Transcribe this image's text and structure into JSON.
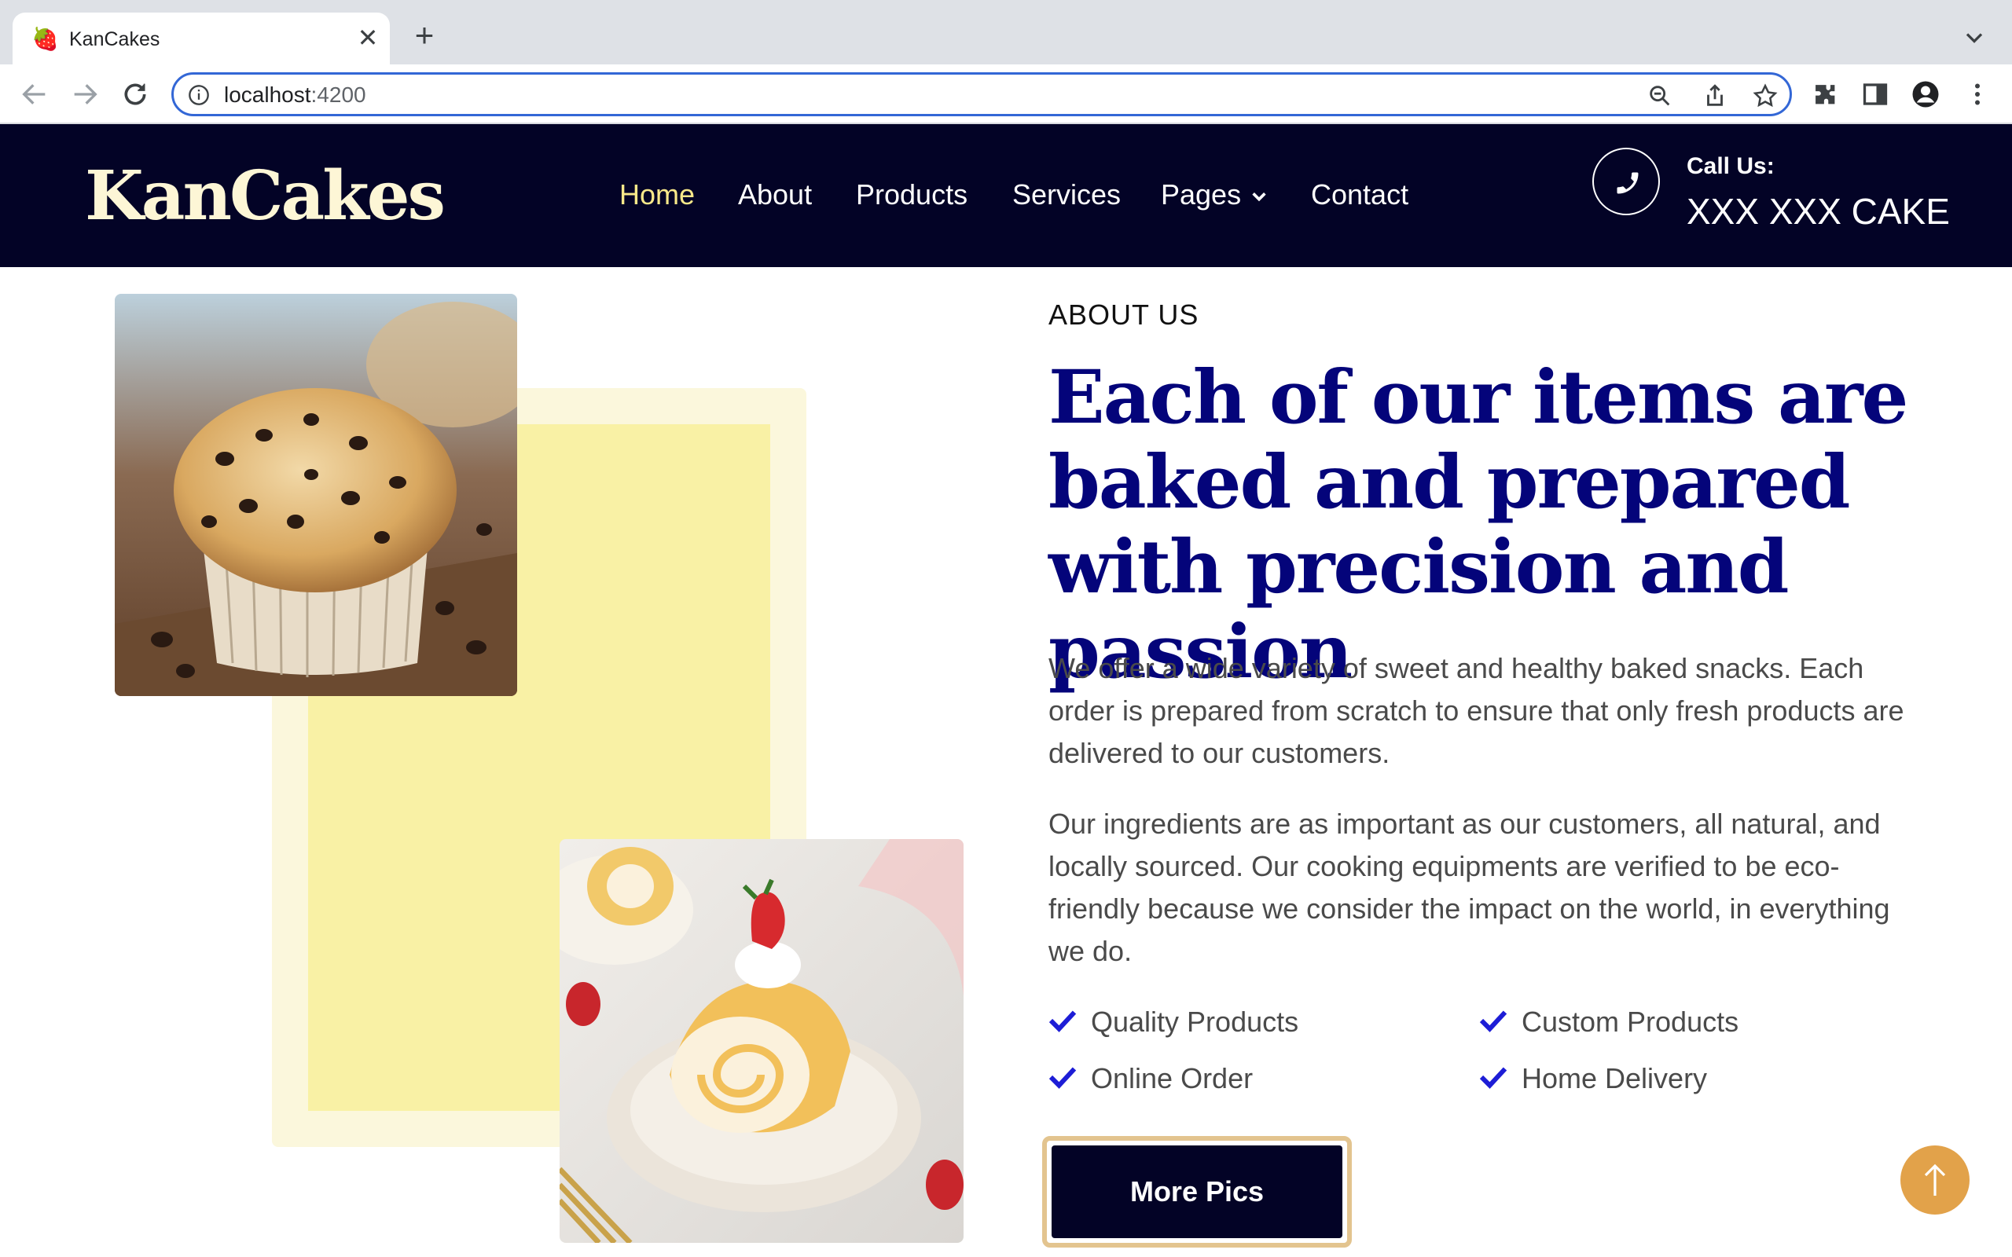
{
  "browser": {
    "tab": {
      "favicon": "🍓",
      "title": "KanCakes",
      "close": "✕"
    },
    "new_tab": "+",
    "url_host": "localhost",
    "url_port": ":4200"
  },
  "header": {
    "brand": "KanCakes",
    "nav": [
      {
        "label": "Home",
        "active": true
      },
      {
        "label": "About",
        "active": false
      },
      {
        "label": "Products",
        "active": false
      },
      {
        "label": "Services",
        "active": false
      },
      {
        "label": "Pages",
        "active": false,
        "dropdown": true
      },
      {
        "label": "Contact",
        "active": false
      }
    ],
    "call_label": "Call Us:",
    "call_number": "XXX XXX CAKE"
  },
  "about": {
    "eyebrow": "ABOUT US",
    "headline": "Each of our items are baked and prepared with precision and passion",
    "paragraph_1": "We offer a wide variety of sweet and healthy baked snacks. Each order is prepared from scratch to ensure that only fresh products are delivered to our customers.",
    "paragraph_2": "Our ingredients are as important as our customers, all natural, and locally sourced. Our cooking equipments are verified to be eco-friendly because we consider the impact on the world, in everything we do.",
    "features": [
      "Quality Products",
      "Custom Products",
      "Online Order",
      "Home Delivery"
    ],
    "button": "More Pics"
  },
  "colors": {
    "header_bg": "#030326",
    "brand": "#fdf6d6",
    "nav_active": "#f9e98a",
    "headline": "#04047a",
    "check": "#1d1dd6",
    "accent_yellow": "#f9f1a5",
    "button_border": "#e3c48f",
    "to_top": "#e2a24a"
  }
}
